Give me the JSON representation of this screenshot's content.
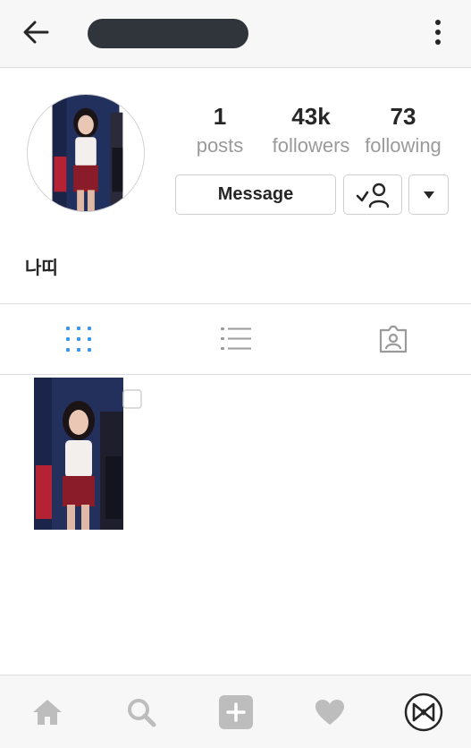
{
  "header": {
    "back_icon": "arrow-left-icon",
    "more_icon": "more-vertical-icon"
  },
  "profile": {
    "stats": {
      "posts_count": "1",
      "posts_label": "posts",
      "followers_count": "43k",
      "followers_label": "followers",
      "following_count": "73",
      "following_label": "following"
    },
    "actions": {
      "message_label": "Message",
      "following_icon": "person-check-icon",
      "dropdown_icon": "caret-down-icon"
    },
    "bio_name": "나띠"
  },
  "tabs": [
    {
      "name": "grid",
      "icon": "grid-icon",
      "active": true
    },
    {
      "name": "list",
      "icon": "list-icon",
      "active": false
    },
    {
      "name": "tagged",
      "icon": "tagged-photo-icon",
      "active": false
    }
  ],
  "posts": [
    {
      "type": "photo",
      "multi_photo": true
    }
  ],
  "bottom_nav": [
    {
      "name": "home",
      "icon": "home-icon"
    },
    {
      "name": "search",
      "icon": "search-icon"
    },
    {
      "name": "add",
      "icon": "plus-square-icon"
    },
    {
      "name": "activity",
      "icon": "heart-icon"
    },
    {
      "name": "profile",
      "icon": "profile-logo-icon"
    }
  ],
  "colors": {
    "accent_blue": "#3897f0",
    "text_dark": "#262626",
    "text_muted": "#9a9a9a",
    "icon_muted": "#bdbdbd",
    "bar_bg": "#f7f7f7",
    "border": "#dcdcdc"
  }
}
